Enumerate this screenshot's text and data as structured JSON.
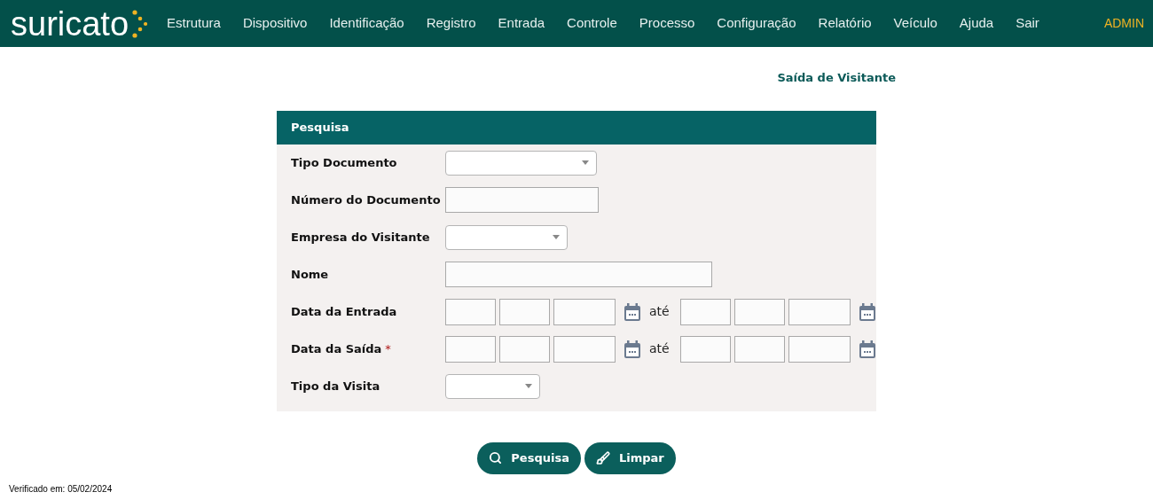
{
  "navbar": {
    "logo": "suricato",
    "items": [
      "Estrutura",
      "Dispositivo",
      "Identificação",
      "Registro",
      "Entrada",
      "Controle",
      "Processo",
      "Configuração",
      "Relatório",
      "Veículo",
      "Ajuda",
      "Sair"
    ],
    "user": "ADMIN"
  },
  "page_title": "Saída de Visitante",
  "panel": {
    "title": "Pesquisa",
    "fields": [
      {
        "label": "Tipo Documento",
        "kind": "select"
      },
      {
        "label": "Número do Documento",
        "kind": "text"
      },
      {
        "label": "Empresa do Visitante",
        "kind": "select"
      },
      {
        "label": "Nome",
        "kind": "text"
      },
      {
        "label": "Data da Entrada",
        "kind": "daterange",
        "separator": "até"
      },
      {
        "label": "Data da Saída",
        "kind": "daterange",
        "required_mark": "*",
        "separator": "até"
      },
      {
        "label": "Tipo da Visita",
        "kind": "select"
      }
    ]
  },
  "buttons": [
    {
      "label": "Pesquisa",
      "kind": "search"
    },
    {
      "label": "Limpar",
      "kind": "clear"
    }
  ],
  "footer": "Verificado em: 05/02/2024"
}
